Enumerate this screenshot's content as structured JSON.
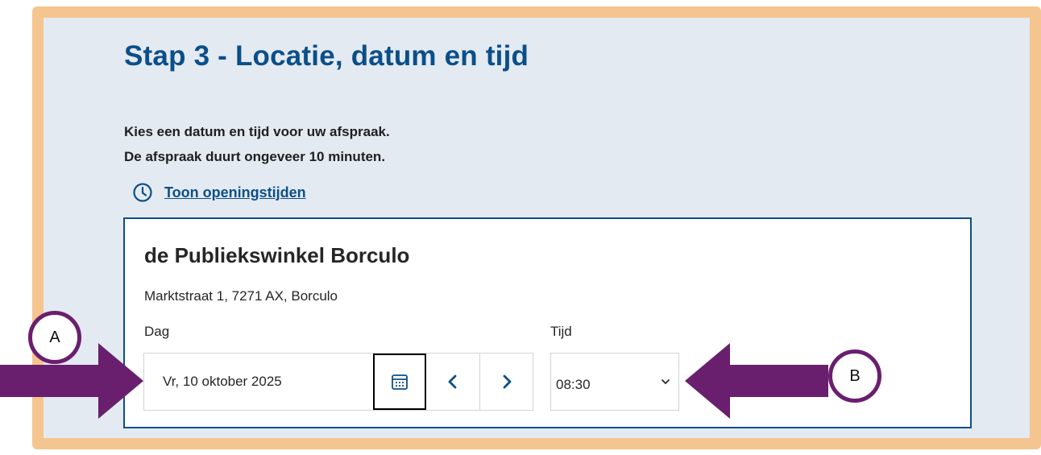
{
  "page": {
    "title": "Stap 3 - Locatie, datum en tijd",
    "intro_line1": "Kies een datum en tijd voor uw afspraak.",
    "intro_line2": "De afspraak duurt ongeveer 10 minuten.",
    "hours_link": "Toon openingstijden"
  },
  "location": {
    "name": "de Publiekswinkel Borculo",
    "address": "Marktstraat 1, 7271 AX, Borculo"
  },
  "date_field": {
    "label": "Dag",
    "value": "Vr, 10 oktober 2025",
    "calendar_icon": "calendar-icon",
    "prev_icon": "chevron-left-icon",
    "next_icon": "chevron-right-icon"
  },
  "time_field": {
    "label": "Tijd",
    "value": "08:30",
    "dropdown_icon": "chevron-down-icon"
  },
  "annotations": {
    "badge_a": "A",
    "badge_b": "B",
    "color": "#6a1f6e"
  },
  "colors": {
    "frame": "#f5c58f",
    "background": "#e4eaf1",
    "brand_blue": "#0b4f8a"
  }
}
